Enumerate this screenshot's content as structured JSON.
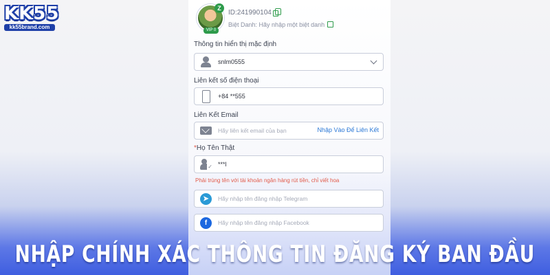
{
  "brand": {
    "logo": "KK55",
    "domain": "kk55brand.com"
  },
  "profile": {
    "id": "ID:241990104",
    "vip_tag": "VIP 0",
    "level_badge": "Z",
    "nickname_label": "Biệt Danh:",
    "nickname_placeholder": "Hãy nhập một biệt danh"
  },
  "form": {
    "default_info_label": "Thông tin hiển thị mặc định",
    "default_info_value": "snlm0555",
    "phone_label": "Liên kết số điện thoại",
    "phone_value": "+84 **555",
    "email_label": "Liên Kết Email",
    "email_placeholder": "Hãy liên kết email của bạn",
    "email_link": "Nhập Vào Để Liên Kết",
    "realname_required_mark": "*",
    "realname_label": "Họ Tên Thật",
    "realname_value": "***l",
    "realname_hint": "Phải trùng tên với tài khoản ngân hàng rút tiền, chỉ viết hoa",
    "telegram_placeholder": "Hãy nhập tên đăng nhập Telegram",
    "facebook_placeholder": "Hãy nhập tên đăng nhập Facebook"
  },
  "banner": {
    "headline": "NHẬP CHÍNH XÁC THÔNG TIN ĐĂNG KÝ BAN ĐẦU"
  },
  "colors": {
    "accent_green": "#2e9b4b",
    "link_blue": "#2b78d6",
    "hint_red": "#e15a4a",
    "banner_blue": "#3f5ee0"
  },
  "icons": [
    "copy-icon",
    "edit-icon",
    "user-icon",
    "chevron-down-icon",
    "phone-icon",
    "mail-icon",
    "person-check-icon",
    "telegram-icon",
    "facebook-icon"
  ]
}
